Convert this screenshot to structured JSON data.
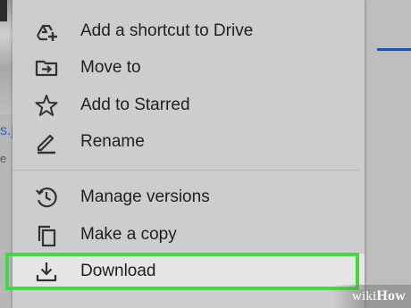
{
  "background": {
    "left_filename": "s.j",
    "left_meta": "e"
  },
  "menu": {
    "items": [
      {
        "label": "Add a shortcut to Drive",
        "icon": "add-shortcut-icon"
      },
      {
        "label": "Move to",
        "icon": "move-to-folder-icon"
      },
      {
        "label": "Add to Starred",
        "icon": "star-icon"
      },
      {
        "label": "Rename",
        "icon": "pencil-icon"
      },
      {
        "label": "Manage versions",
        "icon": "history-icon"
      },
      {
        "label": "Make a copy",
        "icon": "copy-icon"
      },
      {
        "label": "Download",
        "icon": "download-icon"
      }
    ]
  },
  "highlight_color": "#3fdc3f",
  "watermark": {
    "part1": "wiki",
    "part2": "How"
  }
}
